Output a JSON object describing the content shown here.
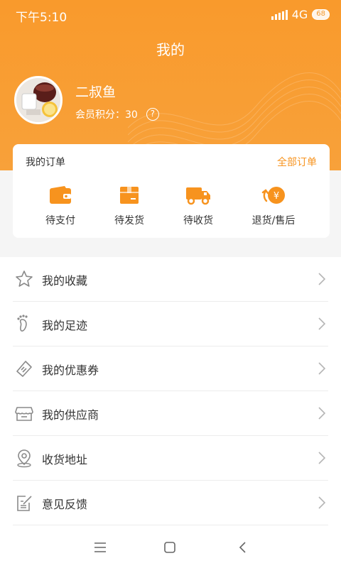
{
  "status": {
    "time": "下午5:10",
    "network": "4G",
    "battery": "68"
  },
  "header": {
    "title": "我的"
  },
  "profile": {
    "name": "二叔鱼",
    "points_label": "会员积分：30",
    "help_symbol": "?"
  },
  "orders": {
    "title": "我的订单",
    "all_label": "全部订单",
    "items": [
      {
        "label": "待支付",
        "icon": "wallet-icon"
      },
      {
        "label": "待发货",
        "icon": "box-icon"
      },
      {
        "label": "待收货",
        "icon": "truck-icon"
      },
      {
        "label": "退货/售后",
        "icon": "refund-icon"
      }
    ]
  },
  "menu": {
    "items": [
      {
        "label": "我的收藏",
        "icon": "star-icon"
      },
      {
        "label": "我的足迹",
        "icon": "footprint-icon"
      },
      {
        "label": "我的优惠券",
        "icon": "coupon-icon"
      },
      {
        "label": "我的供应商",
        "icon": "store-icon"
      },
      {
        "label": "收货地址",
        "icon": "location-icon"
      },
      {
        "label": "意见反馈",
        "icon": "feedback-icon"
      }
    ]
  },
  "colors": {
    "accent": "#f7931e",
    "header": "#f99a2c"
  }
}
